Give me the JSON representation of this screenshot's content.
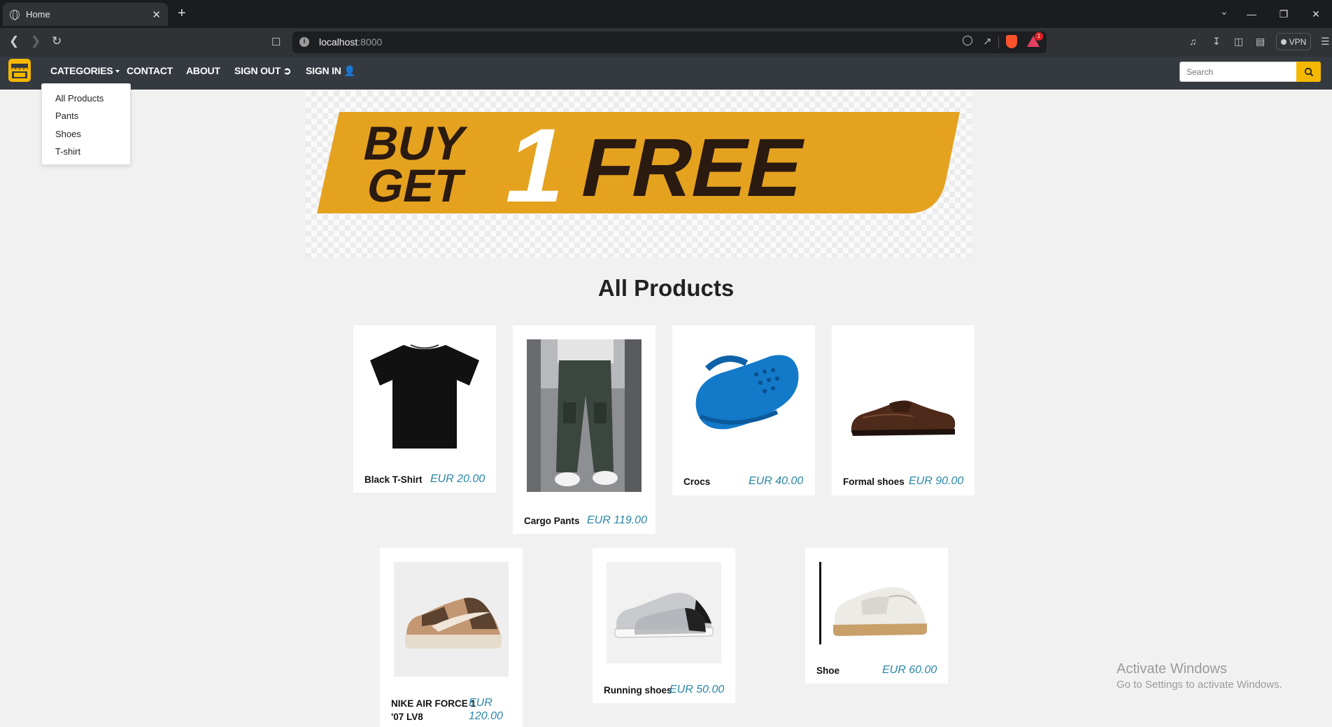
{
  "browser": {
    "tab_title": "Home",
    "tab_close": "✕",
    "new_tab": "+",
    "url_host": "localhost",
    "url_port": ":8000",
    "info_icon": "i",
    "badge_count": "1",
    "vpn_label": "VPN"
  },
  "navbar": {
    "categories": "CATEGORIES",
    "contact": "CONTACT",
    "about": "ABOUT",
    "sign_out": "SIGN OUT",
    "sign_in": "SIGN IN",
    "search_placeholder": "Search"
  },
  "dropdown": {
    "items": [
      "All Products",
      "Pants",
      "Shoes",
      "T-shirt"
    ]
  },
  "banner": {
    "line1": "BUY",
    "line2": "GET",
    "number": "1",
    "word": "FREE"
  },
  "section_title": "All Products",
  "products": [
    {
      "name": "Black T-Shirt",
      "price": "EUR  20.00"
    },
    {
      "name": "Cargo Pants",
      "price": "EUR  119.00"
    },
    {
      "name": "Crocs",
      "price": "EUR  40.00"
    },
    {
      "name": "Formal shoes",
      "price": "EUR  90.00"
    },
    {
      "name_line1": "NIKE AIR FORCE 1",
      "name_line2": "'07 LV8",
      "price_line1": "EUR",
      "price_line2": "120.00"
    },
    {
      "name": "Running shoes",
      "price": "EUR  50.00"
    },
    {
      "name": "Shoe",
      "price": "EUR  60.00"
    }
  ],
  "os_overlay": {
    "line1": "Activate Windows",
    "line2": "Go to Settings to activate Windows."
  },
  "colors": {
    "navbar_bg": "#343a40",
    "accent_yellow": "#f5b800",
    "price_blue": "#2a86a8",
    "banner_orange": "#e5a21f",
    "banner_dark": "#2a1a10"
  }
}
